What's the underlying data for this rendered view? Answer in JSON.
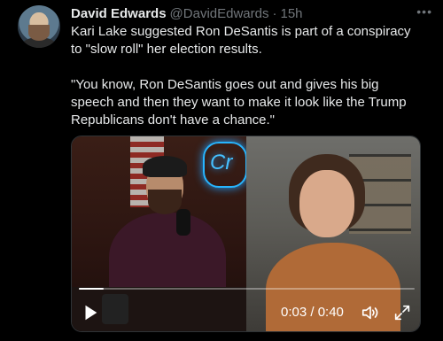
{
  "author": {
    "name": "David Edwards",
    "handle": "@DavidEdwards",
    "separator": "·",
    "time": "15h"
  },
  "more_label": "•••",
  "tweet": {
    "paragraphs": [
      "Kari Lake suggested Ron DeSantis is part of a conspiracy to \"slow roll\" her election results.",
      "\"You know, Ron DeSantis goes out and gives his big speech and then they want to make it look like the Trump Republicans don't have a chance.\""
    ]
  },
  "video": {
    "neon_sign": "Cr",
    "progress": 0.075,
    "time_display": "0:03 / 0:40"
  },
  "icons": {
    "play": "play-icon",
    "volume": "volume-icon",
    "fullscreen": "fullscreen-icon",
    "more": "more-icon"
  },
  "colors": {
    "background": "#000000",
    "text": "#e7e9ea",
    "muted": "#71767b",
    "border": "#2f3336"
  }
}
